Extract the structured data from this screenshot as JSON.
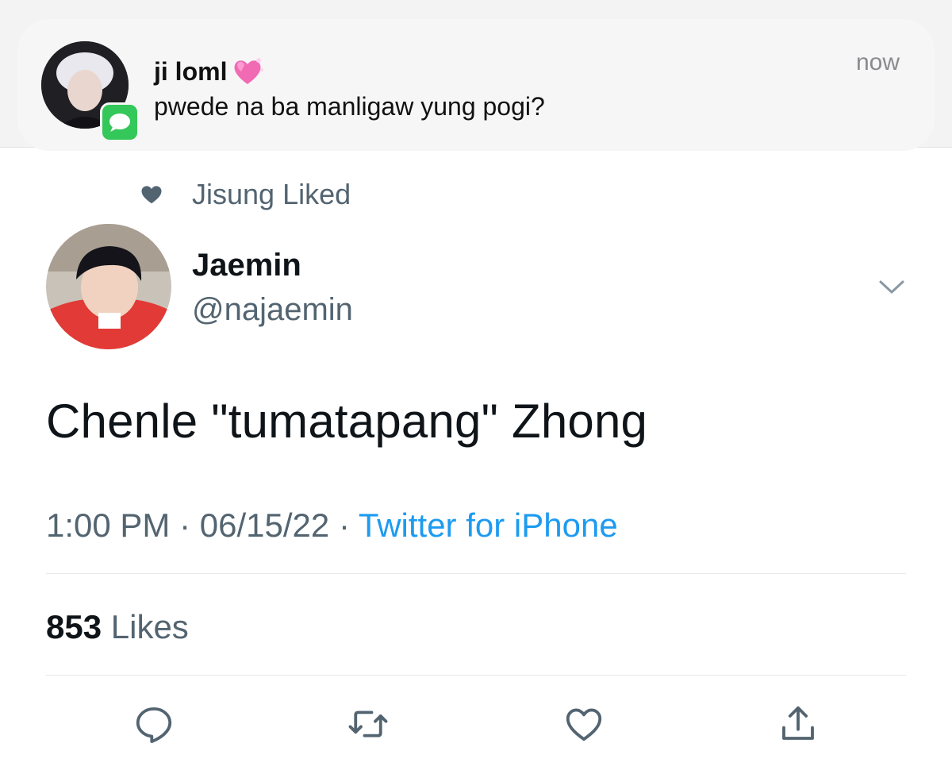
{
  "notification": {
    "sender": "ji loml",
    "message": "pwede na ba manligaw yung pogi?",
    "time": "now",
    "app_icon": "messages-icon",
    "sender_emoji": "sparkling-heart-icon"
  },
  "social_context": {
    "icon": "heart-icon",
    "text": "Jisung Liked"
  },
  "author": {
    "name": "Jaemin",
    "handle": "@najaemin"
  },
  "tweet": {
    "text": "Chenle \"tumatapang\" Zhong",
    "time": "1:00 PM",
    "separator": "·",
    "date": "06/15/22",
    "source": "Twitter for iPhone"
  },
  "stats": {
    "likes_count": "853",
    "likes_label": "Likes"
  },
  "actions": [
    {
      "name": "reply",
      "icon": "reply-icon"
    },
    {
      "name": "retweet",
      "icon": "retweet-icon"
    },
    {
      "name": "like",
      "icon": "like-icon"
    },
    {
      "name": "share",
      "icon": "share-icon"
    }
  ],
  "colors": {
    "accent": "#1d9bf0",
    "secondary_text": "#536471",
    "messages_green": "#34c759"
  }
}
